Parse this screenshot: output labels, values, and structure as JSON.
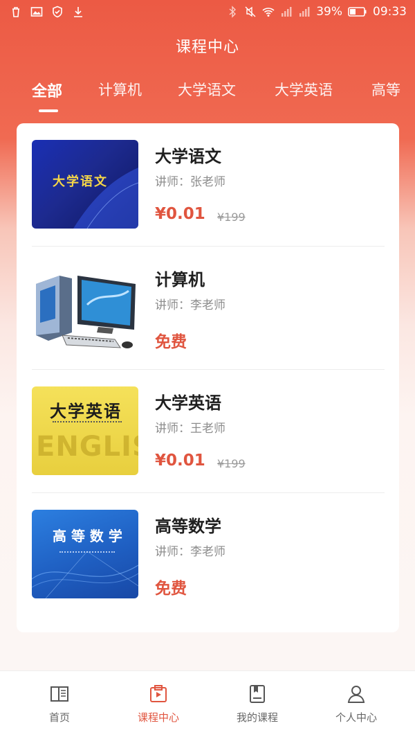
{
  "status_bar": {
    "battery": "39%",
    "time": "09:33"
  },
  "header": {
    "title": "课程中心"
  },
  "tabs": [
    {
      "label": "全部",
      "active": true
    },
    {
      "label": "计算机",
      "active": false
    },
    {
      "label": "大学语文",
      "active": false
    },
    {
      "label": "大学英语",
      "active": false
    },
    {
      "label": "高等",
      "active": false
    }
  ],
  "courses": [
    {
      "title": "大学语文",
      "teacher": "讲师：张老师",
      "price": "¥0.01",
      "original_price": "¥199",
      "thumb_text": "大学语文"
    },
    {
      "title": "计算机",
      "teacher": "讲师：李老师",
      "price": "免费",
      "original_price": "",
      "thumb_text": ""
    },
    {
      "title": "大学英语",
      "teacher": "讲师：王老师",
      "price": "¥0.01",
      "original_price": "¥199",
      "thumb_text": "大学英语",
      "thumb_subtext": "ENGLISH"
    },
    {
      "title": "高等数学",
      "teacher": "讲师：李老师",
      "price": "免费",
      "original_price": "",
      "thumb_text": "高 等 数 学"
    }
  ],
  "bottom_nav": [
    {
      "label": "首页",
      "icon": "home-book-icon",
      "active": false
    },
    {
      "label": "课程中心",
      "icon": "course-play-icon",
      "active": true
    },
    {
      "label": "我的课程",
      "icon": "my-course-book-icon",
      "active": false
    },
    {
      "label": "个人中心",
      "icon": "person-icon",
      "active": false
    }
  ],
  "colors": {
    "accent": "#e0553f",
    "header_gradient_top": "#ec5a44"
  }
}
